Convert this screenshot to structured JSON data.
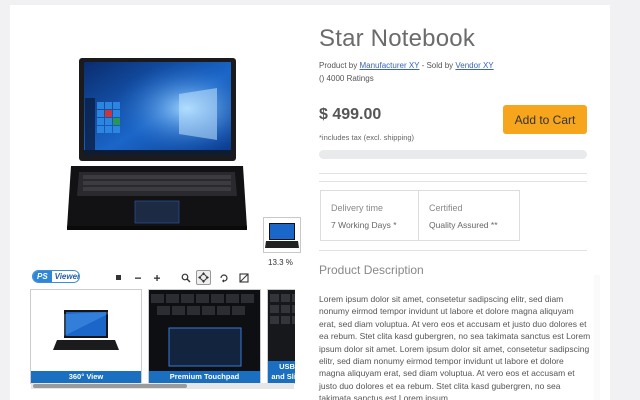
{
  "product": {
    "title": "Star Notebook",
    "byline_prefix": "Product by ",
    "manufacturer": "Manufacturer XY",
    "sold_by_prefix": " - Sold by ",
    "vendor": "Vendor XY",
    "ratings": "() 4000 Ratings",
    "price": "$ 499.00",
    "tax_note": "*includes tax (excl. shipping)",
    "add_to_cart": "Add to Cart",
    "progress": 0
  },
  "info": {
    "delivery_label": "Delivery time",
    "delivery_value": "7 Working Days *",
    "certified_label": "Certified",
    "certified_value": "Quality Assured **"
  },
  "description": {
    "title": "Product Description",
    "text": "Lorem ipsum dolor sit amet, consetetur sadipscing elitr, sed diam nonumy eirmod tempor invidunt ut labore et dolore magna aliquyam erat, sed diam voluptua. At vero eos et accusam et justo duo dolores et ea rebum. Stet clita kasd gubergren, no sea takimata sanctus est Lorem ipsum dolor sit amet. Lorem ipsum dolor sit amet, consetetur sadipscing elitr, sed diam nonumy eirmod tempor invidunt ut labore et dolore magna aliquyam erat, sed diam voluptua. At vero eos et accusam et justo duo dolores et ea rebum. Stet clita kasd gubergren, no sea takimata sanctus est Lorem ipsum"
  },
  "viewer": {
    "logo_ps": "PS",
    "logo_viewer": "Viewer",
    "zoom_label": "13.3 %",
    "tools": [
      "stop-icon",
      "minus-icon",
      "plus-icon",
      "magnifier-icon",
      "move-icon",
      "rotate-icon",
      "fullscreen-icon"
    ],
    "thumbnails": [
      {
        "caption": "360° View"
      },
      {
        "caption": "Premium Touchpad"
      },
      {
        "caption": "USB",
        "caption2": "and Slim Ke"
      }
    ]
  },
  "colors": {
    "accent_button": "#f7a51c",
    "link": "#3a63b8",
    "viewer_blue": "#1a6fc0"
  }
}
